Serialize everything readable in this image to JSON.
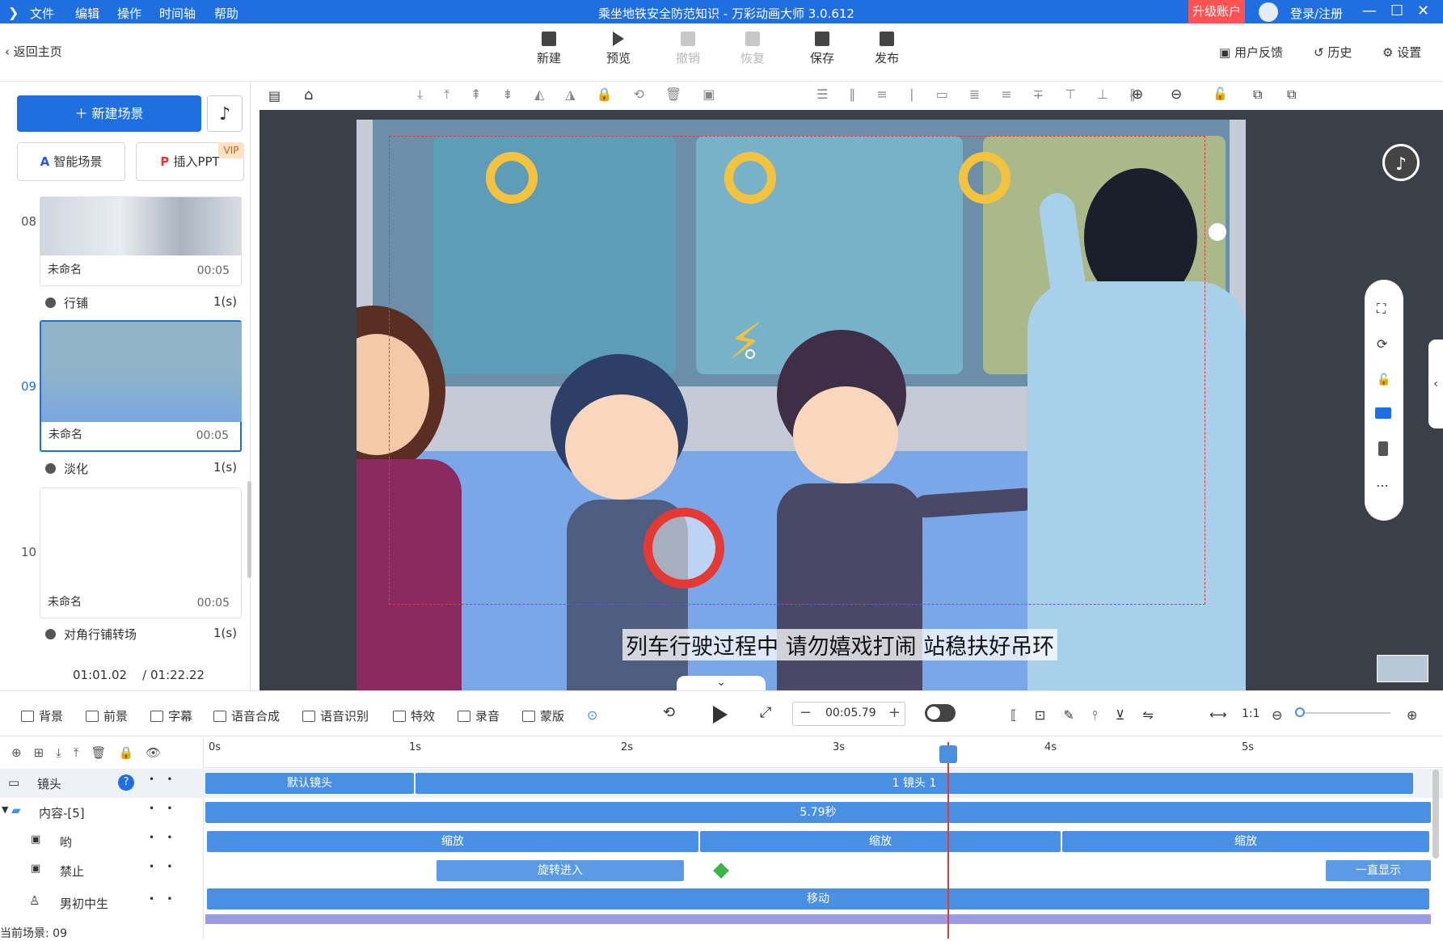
{
  "titlebar": {
    "menus": [
      "文件",
      "编辑",
      "操作",
      "时间轴",
      "帮助"
    ],
    "title": "乘坐地铁安全防范知识 - 万彩动画大师 3.0.612",
    "upgrade": "升级账户",
    "login": "登录/注册"
  },
  "toolbar": {
    "back": "返回主页",
    "new": "新建",
    "preview": "预览",
    "undo": "撤销",
    "redo": "恢复",
    "save": "保存",
    "publish": "发布",
    "feedback": "用户反馈",
    "history": "历史",
    "settings": "设置"
  },
  "leftpanel": {
    "new_scene": "新建场景",
    "smart_scene": "智能场景",
    "insert_ppt": "插入PPT",
    "vip": "VIP",
    "scenes": [
      {
        "num": "08",
        "name": "未命名",
        "time": "00:05",
        "transition": "行铺",
        "duration": "1(s)"
      },
      {
        "num": "09",
        "name": "未命名",
        "time": "00:05",
        "transition": "淡化",
        "duration": "1(s)"
      },
      {
        "num": "10",
        "name": "未命名",
        "time": "00:05",
        "transition": "对角行铺转场",
        "duration": "1(s)"
      }
    ],
    "current_time": "01:01.02",
    "total_time": "/ 01:22.22"
  },
  "canvas": {
    "subtitle": "列车行驶过程中 请勿嬉戏打闹 站稳扶好吊环"
  },
  "bottom_toolbar": {
    "items": [
      "背景",
      "前景",
      "字幕",
      "语音合成",
      "语音识别",
      "特效",
      "录音",
      "蒙版"
    ],
    "time": "00:05.79"
  },
  "timeline": {
    "ticks": [
      "0s",
      "1s",
      "2s",
      "3s",
      "4s",
      "5s"
    ],
    "rows": [
      {
        "label": "镜头"
      },
      {
        "label": "内容-[5]"
      },
      {
        "label": "哟"
      },
      {
        "label": "禁止"
      },
      {
        "label": "男初中生"
      }
    ],
    "bars": {
      "camera_default": "默认镜头",
      "camera_1": "1 镜头 1",
      "content_total": "5.79秒",
      "zoom1": "缩放",
      "zoom2": "缩放",
      "zoom3": "缩放",
      "rotate_in": "旋转进入",
      "always_show": "一直显示",
      "move": "移动"
    },
    "status": "当前场景: 09"
  }
}
